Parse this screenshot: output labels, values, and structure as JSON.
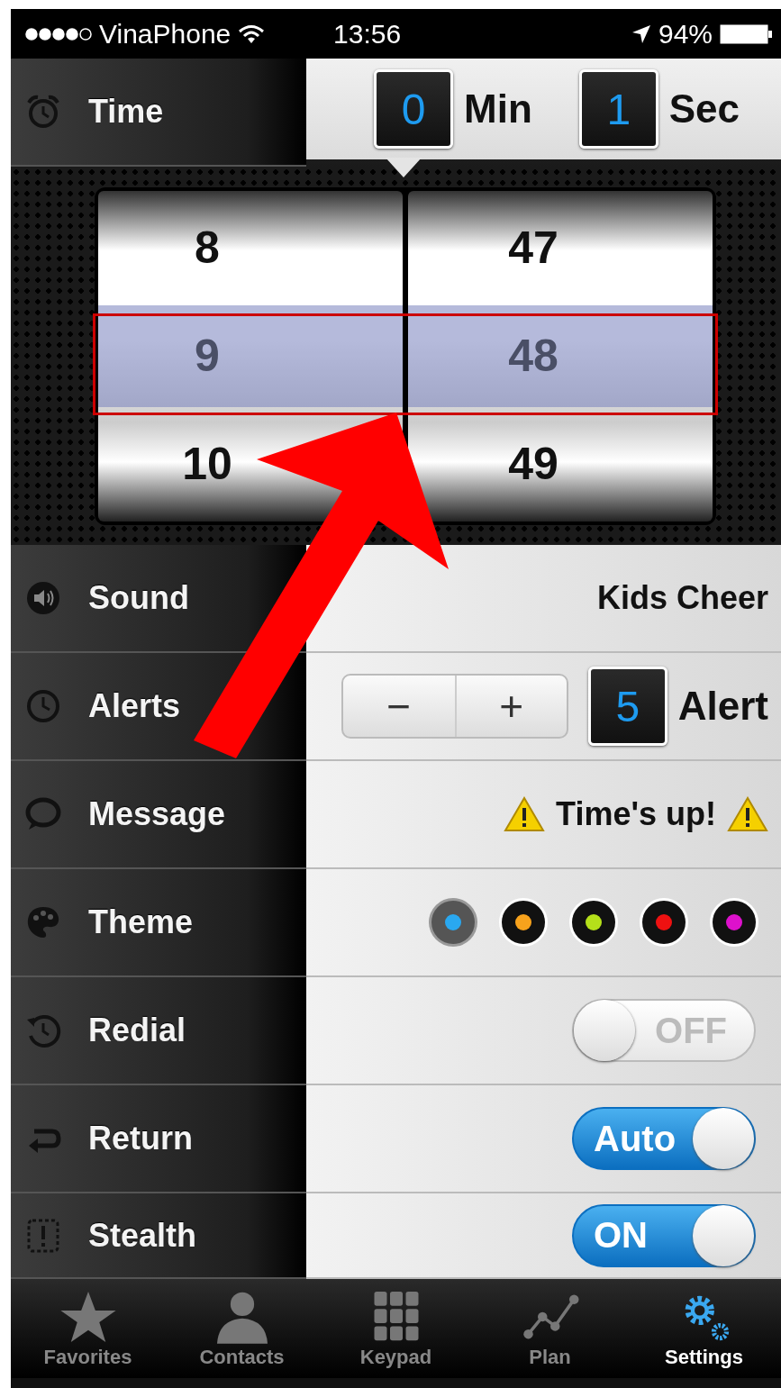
{
  "status_bar": {
    "carrier": "VinaPhone",
    "time": "13:56",
    "battery": "94%"
  },
  "time_row": {
    "label": "Time",
    "minutes": "0",
    "minutes_unit": "Min",
    "seconds": "1",
    "seconds_unit": "Sec"
  },
  "picker": {
    "columns": [
      {
        "values": [
          {
            "text": "8",
            "selected": false
          },
          {
            "text": "9",
            "selected": true
          },
          {
            "text": "10",
            "selected": false
          }
        ]
      },
      {
        "values": [
          {
            "text": "47",
            "selected": false
          },
          {
            "text": "48",
            "selected": true
          },
          {
            "text": "49",
            "selected": false
          }
        ]
      }
    ]
  },
  "settings": [
    {
      "kind": "value",
      "label": "Sound",
      "value": "Kids Cheer"
    },
    {
      "kind": "stepper",
      "label": "Alerts",
      "minus": "−",
      "plus": "+",
      "count": "5",
      "unit": "Alert"
    },
    {
      "kind": "message",
      "label": "Message",
      "value": "Time's up!"
    },
    {
      "kind": "colors",
      "label": "Theme",
      "colors": [
        {
          "color": "#2aa8f0",
          "selected": true
        },
        {
          "color": "#f7a21c",
          "selected": false
        },
        {
          "color": "#b5e01a",
          "selected": false
        },
        {
          "color": "#ee1111",
          "selected": false
        },
        {
          "color": "#dd11cc",
          "selected": false
        }
      ]
    },
    {
      "kind": "toggle",
      "label": "Redial",
      "on": false,
      "text": "OFF"
    },
    {
      "kind": "toggle",
      "label": "Return",
      "on": true,
      "text": "Auto"
    },
    {
      "kind": "toggle",
      "label": "Stealth",
      "on": true,
      "text": "ON"
    }
  ],
  "tab_bar": [
    {
      "label": "Favorites",
      "selected": false
    },
    {
      "label": "Contacts",
      "selected": false
    },
    {
      "label": "Keypad",
      "selected": false
    },
    {
      "label": "Plan",
      "selected": false
    },
    {
      "label": "Settings",
      "selected": true
    }
  ]
}
